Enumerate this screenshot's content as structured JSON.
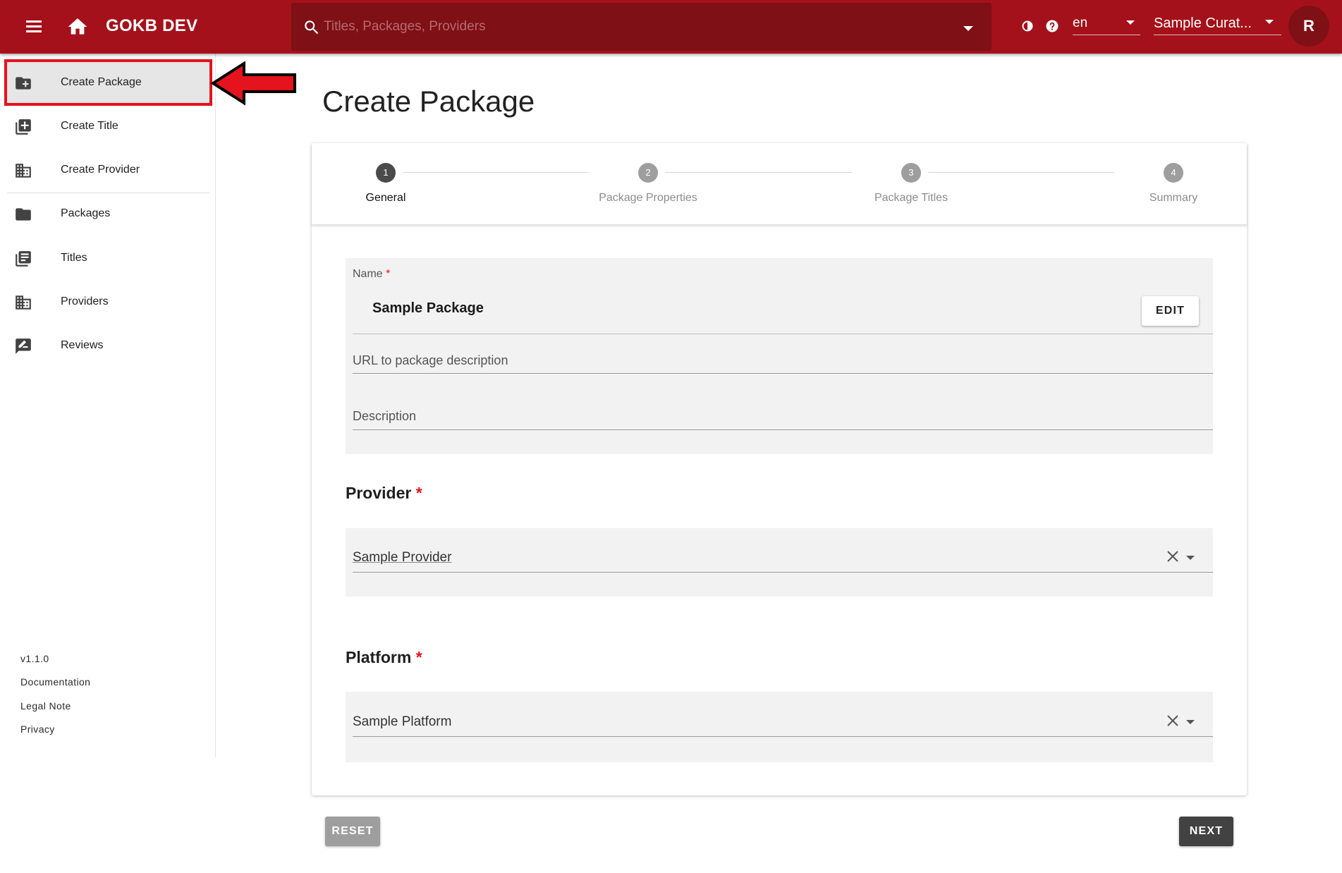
{
  "app": {
    "title": "GOKB DEV"
  },
  "search": {
    "placeholder": "Titles, Packages, Providers"
  },
  "toolbar": {
    "language": "en",
    "user": "Sample Curat...",
    "avatar_initial": "R"
  },
  "sidebar": {
    "items": [
      {
        "label": "Create Package",
        "icon": "create-package-icon",
        "active": true
      },
      {
        "label": "Create Title",
        "icon": "create-title-icon"
      },
      {
        "label": "Create Provider",
        "icon": "create-provider-icon"
      },
      {
        "label": "Packages",
        "icon": "folder-icon"
      },
      {
        "label": "Titles",
        "icon": "titles-icon"
      },
      {
        "label": "Providers",
        "icon": "providers-icon"
      },
      {
        "label": "Reviews",
        "icon": "reviews-icon"
      }
    ],
    "footer": {
      "version": "v1.1.0",
      "documentation": "Documentation",
      "legal_note": "Legal Note",
      "privacy": "Privacy"
    }
  },
  "page": {
    "title": "Create Package"
  },
  "stepper": {
    "steps": [
      {
        "number": "1",
        "label": "General",
        "active": true
      },
      {
        "number": "2",
        "label": "Package Properties"
      },
      {
        "number": "3",
        "label": "Package Titles"
      },
      {
        "number": "4",
        "label": "Summary"
      }
    ]
  },
  "form": {
    "name": {
      "label": "Name",
      "required_mark": "*",
      "value": "Sample Package",
      "edit_label": "EDIT"
    },
    "url": {
      "label": "URL to package description"
    },
    "description": {
      "label": "Description"
    },
    "provider": {
      "heading": "Provider",
      "required_mark": "*",
      "value": "Sample Provider"
    },
    "platform": {
      "heading": "Platform",
      "required_mark": "*",
      "value": "Sample Platform"
    }
  },
  "actions": {
    "reset": "RESET",
    "next": "NEXT"
  },
  "colors": {
    "brand": "#a5111a",
    "brand_dark": "#7e1016",
    "required": "#e5131d",
    "highlight": "#e5131d"
  }
}
